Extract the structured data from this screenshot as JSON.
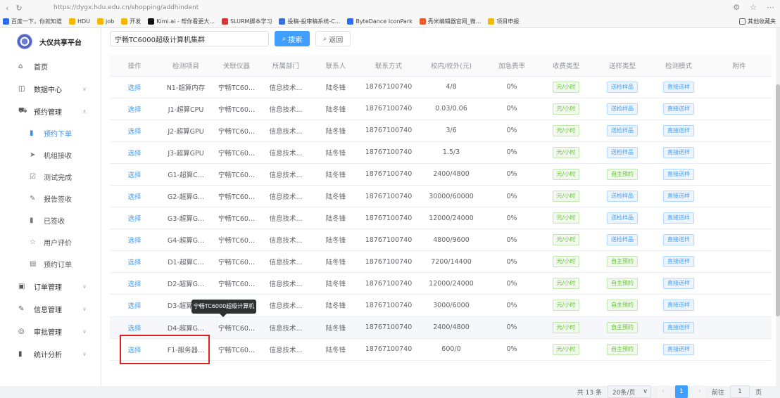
{
  "browser": {
    "url": "https://dygx.hdu.edu.cn/shopping/addhindent",
    "bookmarks": [
      "百度一下，你就知道",
      "HDU",
      "job",
      "开发",
      "Kimi.ai - 帮你看更大...",
      "SLURM脚本学习",
      "投稿-投审稿系统-C...",
      "ByteDance IconPark",
      "秀米编辑器官网_微...",
      "项目申报"
    ],
    "other_bookmarks": "其他收藏夹"
  },
  "sidebar": {
    "logo_title": "大仪共享平台",
    "menu": [
      {
        "label": "首页",
        "icon": "home-icon",
        "glyph": "⌂",
        "chevron": ""
      },
      {
        "label": "数据中心",
        "icon": "data-icon",
        "glyph": "◫",
        "chevron": "∨"
      },
      {
        "label": "预约管理",
        "icon": "cart-icon",
        "glyph": "⛟",
        "chevron": "∧"
      }
    ],
    "submenu": [
      {
        "label": "预约下单",
        "icon": "bar-chart-icon",
        "glyph": "▮",
        "active": true
      },
      {
        "label": "机组接收",
        "icon": "send-icon",
        "glyph": "➤",
        "active": false
      },
      {
        "label": "测试完成",
        "icon": "checkbox-icon",
        "glyph": "☑",
        "active": false
      },
      {
        "label": "报告签收",
        "icon": "edit-icon",
        "glyph": "✎",
        "active": false
      },
      {
        "label": "已签收",
        "icon": "bar-chart-icon",
        "glyph": "▮",
        "active": false
      },
      {
        "label": "用户评价",
        "icon": "star-icon",
        "glyph": "☆",
        "active": false
      },
      {
        "label": "预约订单",
        "icon": "document-icon",
        "glyph": "▤",
        "active": false
      }
    ],
    "menu_bottom": [
      {
        "label": "订单管理",
        "icon": "order-icon",
        "glyph": "▣",
        "chevron": "∨"
      },
      {
        "label": "信息管理",
        "icon": "info-edit-icon",
        "glyph": "✎",
        "chevron": "∨"
      },
      {
        "label": "审批管理",
        "icon": "approval-icon",
        "glyph": "◎",
        "chevron": "∨"
      },
      {
        "label": "统计分析",
        "icon": "stats-icon",
        "glyph": "▮",
        "chevron": "∨"
      }
    ]
  },
  "search": {
    "value": "宁畅TC6000超级计算机集群",
    "search_label": "搜索",
    "back_label": "返回"
  },
  "table": {
    "headers": [
      "操作",
      "检测项目",
      "关联仪器",
      "所属部门",
      "联系人",
      "联系方式",
      "校内/校外(元)",
      "加急费率",
      "收费类型",
      "送样类型",
      "检测模式",
      "附件"
    ],
    "rows": [
      {
        "action": "选择",
        "item": "N1-超算内存",
        "instrument": "宁畅TC60...",
        "dept": "信息技术...",
        "contact": "陆冬锋",
        "phone": "18767100740",
        "price": "4/8",
        "rate": "0%",
        "fee": "元/小时",
        "sample": "送检样品",
        "mode": "直接送样"
      },
      {
        "action": "选择",
        "item": "J1-超算CPU",
        "instrument": "宁畅TC60...",
        "dept": "信息技术...",
        "contact": "陆冬锋",
        "phone": "18767100740",
        "price": "0.03/0.06",
        "rate": "0%",
        "fee": "元/小时",
        "sample": "送检样品",
        "mode": "直接送样"
      },
      {
        "action": "选择",
        "item": "J2-超算GPU",
        "instrument": "宁畅TC60...",
        "dept": "信息技术...",
        "contact": "陆冬锋",
        "phone": "18767100740",
        "price": "3/6",
        "rate": "0%",
        "fee": "元/小时",
        "sample": "送检样品",
        "mode": "直接送样"
      },
      {
        "action": "选择",
        "item": "J3-超算GPU",
        "instrument": "宁畅TC60...",
        "dept": "信息技术...",
        "contact": "陆冬锋",
        "phone": "18767100740",
        "price": "1.5/3",
        "rate": "0%",
        "fee": "元/小时",
        "sample": "送检样品",
        "mode": "直接送样"
      },
      {
        "action": "选择",
        "item": "G1-超算C...",
        "instrument": "宁畅TC60...",
        "dept": "信息技术...",
        "contact": "陆冬锋",
        "phone": "18767100740",
        "price": "2400/4800",
        "rate": "0%",
        "fee": "元/小时",
        "sample": "自主预约",
        "mode": "直接送样"
      },
      {
        "action": "选择",
        "item": "G2-超算G...",
        "instrument": "宁畅TC60...",
        "dept": "信息技术...",
        "contact": "陆冬锋",
        "phone": "18767100740",
        "price": "30000/60000",
        "rate": "0%",
        "fee": "元/小时",
        "sample": "送检样品",
        "mode": "直接送样"
      },
      {
        "action": "选择",
        "item": "G3-超算G...",
        "instrument": "宁畅TC60...",
        "dept": "信息技术...",
        "contact": "陆冬锋",
        "phone": "18767100740",
        "price": "12000/24000",
        "rate": "0%",
        "fee": "元/小时",
        "sample": "送检样品",
        "mode": "直接送样"
      },
      {
        "action": "选择",
        "item": "G4-超算G...",
        "instrument": "宁畅TC60...",
        "dept": "信息技术...",
        "contact": "陆冬锋",
        "phone": "18767100740",
        "price": "4800/9600",
        "rate": "0%",
        "fee": "元/小时",
        "sample": "送检样品",
        "mode": "直接送样"
      },
      {
        "action": "选择",
        "item": "D1-超算C...",
        "instrument": "宁畅TC60...",
        "dept": "信息技术...",
        "contact": "陆冬锋",
        "phone": "18767100740",
        "price": "7200/14400",
        "rate": "0%",
        "fee": "元/小时",
        "sample": "自主预约",
        "mode": "直接送样"
      },
      {
        "action": "选择",
        "item": "D2-超算G...",
        "instrument": "宁畅TC60...",
        "dept": "信息技术...",
        "contact": "陆冬锋",
        "phone": "18767100740",
        "price": "12000/24000",
        "rate": "0%",
        "fee": "元/小时",
        "sample": "自主预约",
        "mode": "直接送样"
      },
      {
        "action": "选择",
        "item": "D3-超算G...",
        "instrument": "宁畅TC60...",
        "dept": "信息技术...",
        "contact": "陆冬锋",
        "phone": "18767100740",
        "price": "3000/6000",
        "rate": "0%",
        "fee": "元/小时",
        "sample": "自主预约",
        "mode": "直接送样"
      },
      {
        "action": "选择",
        "item": "D4-超算G...",
        "instrument": "宁畅TC60...",
        "dept": "信息技术...",
        "contact": "陆冬锋",
        "phone": "18767100740",
        "price": "2400/4800",
        "rate": "0%",
        "fee": "元/小时",
        "sample": "自主预约",
        "mode": "直接送样"
      },
      {
        "action": "选择",
        "item": "F1-服务器...",
        "instrument": "宁畅TC60...",
        "dept": "信息技术...",
        "contact": "陆冬锋",
        "phone": "18767100740",
        "price": "600/0",
        "rate": "0%",
        "fee": "元/小时",
        "sample": "自主预约",
        "mode": "直接送样"
      }
    ]
  },
  "tooltip": "宁畅TC6000超级计算机集群",
  "pagination": {
    "total": "共 13 条",
    "page_size": "20条/页",
    "current": "1",
    "goto": "前往",
    "goto_value": "1",
    "page_unit": "页"
  },
  "colors": {
    "primary": "#409eff",
    "highlight": "#e02020"
  }
}
